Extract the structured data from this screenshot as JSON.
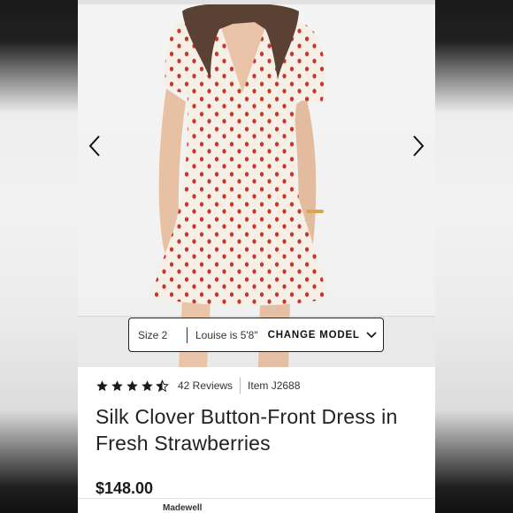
{
  "gallery": {
    "prev_icon": "chevron-left-icon",
    "next_icon": "chevron-right-icon"
  },
  "model_info": {
    "size": "Size 2",
    "model_height": "Louise is 5'8\"",
    "change_label": "CHANGE MODEL",
    "change_icon": "chevron-down-icon"
  },
  "product": {
    "rating": 4.5,
    "reviews": "42 Reviews",
    "item_number": "Item J2688",
    "title": "Silk Clover Button-Front Dress in Fresh Strawberries",
    "price": "$148.00",
    "brand_snippet": "Madewell"
  },
  "colors": {
    "dress_dot": "#c8352b",
    "dress_fabric": "#f6efe6",
    "star": "#1a1a1a"
  }
}
